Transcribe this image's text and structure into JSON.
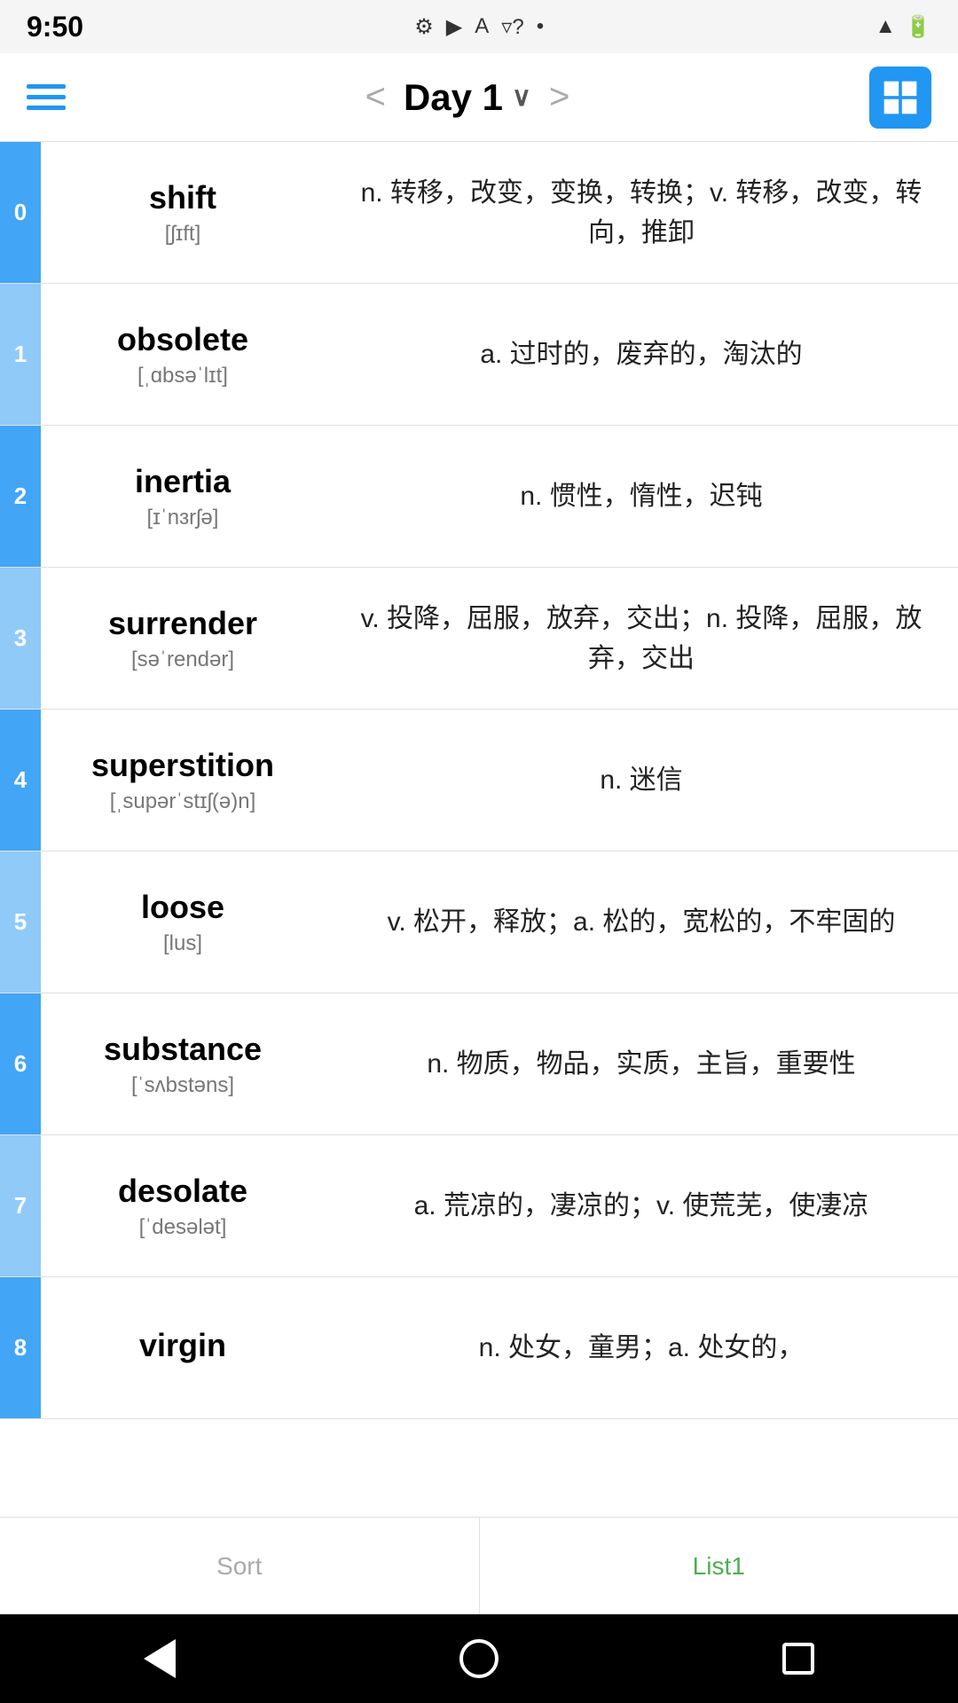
{
  "statusBar": {
    "time": "9:50",
    "icons": [
      "gear",
      "play",
      "A",
      "wifi",
      "dot",
      "signal",
      "battery"
    ]
  },
  "topNav": {
    "title": "Day 1",
    "prevArrow": "<",
    "nextArrow": ">"
  },
  "words": [
    {
      "index": 0,
      "indexClass": "",
      "word": "shift",
      "phonetic": "[ʃɪft]",
      "definition": "n. 转移，改变，变换，转换；v. 转移，改变，转向，推卸"
    },
    {
      "index": 1,
      "indexClass": "light",
      "word": "obsolete",
      "phonetic": "[ˌɑbsəˈlɪt]",
      "definition": "a. 过时的，废弃的，淘汰的"
    },
    {
      "index": 2,
      "indexClass": "",
      "word": "inertia",
      "phonetic": "[ɪˈnɜrʃə]",
      "definition": "n. 惯性，惰性，迟钝"
    },
    {
      "index": 3,
      "indexClass": "light",
      "word": "surrender",
      "phonetic": "[səˈrendər]",
      "definition": "v. 投降，屈服，放弃，交出；n. 投降，屈服，放弃，交出"
    },
    {
      "index": 4,
      "indexClass": "",
      "word": "superstition",
      "phonetic": "[ˌsupərˈstɪʃ(ə)n]",
      "definition": "n. 迷信"
    },
    {
      "index": 5,
      "indexClass": "light",
      "word": "loose",
      "phonetic": "[lus]",
      "definition": "v. 松开，释放；a. 松的，宽松的，不牢固的"
    },
    {
      "index": 6,
      "indexClass": "",
      "word": "substance",
      "phonetic": "[ˈsʌbstəns]",
      "definition": "n. 物质，物品，实质，主旨，重要性"
    },
    {
      "index": 7,
      "indexClass": "light",
      "word": "desolate",
      "phonetic": "[ˈdesələt]",
      "definition": "a. 荒凉的，凄凉的；v. 使荒芜，使凄凉"
    },
    {
      "index": 8,
      "indexClass": "",
      "word": "virgin",
      "phonetic": "",
      "definition": "n. 处女，童男；a. 处女的，"
    }
  ],
  "bottomTabs": [
    {
      "label": "Sort",
      "active": false
    },
    {
      "label": "List1",
      "active": true
    }
  ],
  "androidNav": {
    "back": "◀",
    "home": "●",
    "recents": "■"
  }
}
